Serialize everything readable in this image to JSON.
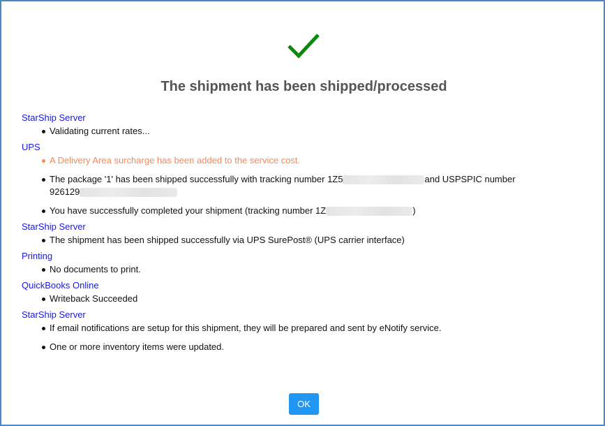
{
  "dialog": {
    "title": "The shipment has been shipped/processed",
    "ok_label": "OK",
    "colors": {
      "accent": "#2196f3",
      "link": "#1a1ad6",
      "warning": "#f28a5c",
      "success": "#0a8a0a",
      "border": "#4a86c8"
    },
    "sections": [
      {
        "title": "StarShip Server",
        "messages": [
          {
            "text": "Validating current rates..."
          }
        ]
      },
      {
        "title": "UPS",
        "messages": [
          {
            "text": "A Delivery Area surcharge has been added to the service cost."
          },
          {
            "text_a": "The package '1' has been shipped successfully with tracking number 1Z5",
            "text_b": "and USPSPIC number",
            "text_c": "926129"
          },
          {
            "text_a": "You have successfully completed your shipment (tracking number 1Z",
            "text_b": ")"
          }
        ]
      },
      {
        "title": "StarShip Server",
        "messages": [
          {
            "text": "The shipment has been shipped successfully via UPS SurePost® (UPS carrier interface)"
          }
        ]
      },
      {
        "title": "Printing",
        "messages": [
          {
            "text": "No documents to print."
          }
        ]
      },
      {
        "title": "QuickBooks Online",
        "messages": [
          {
            "text": "Writeback Succeeded"
          }
        ]
      },
      {
        "title": "StarShip Server",
        "messages": [
          {
            "text": "If email notifications are setup for this shipment, they will be prepared and sent by eNotify service."
          },
          {
            "text": "One or more inventory items were updated."
          }
        ]
      }
    ]
  }
}
